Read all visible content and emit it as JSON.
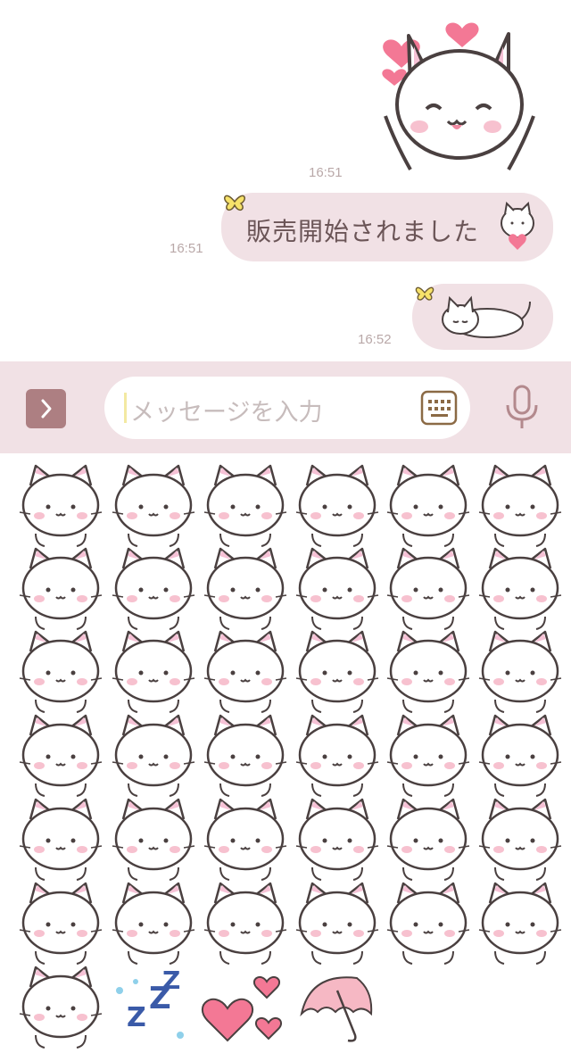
{
  "colors": {
    "bubble": "#f1e1e5",
    "bubble_text": "#6b5557",
    "time_text": "#b9a8a8",
    "composer_bg": "#f1e1e5",
    "toggle_button": "#ad7f82",
    "keyboard_icon": "#8b6a45",
    "mic_icon": "#b3898d",
    "sticker_outline": "#4a4040",
    "sticker_cheek": "#f7c1cf",
    "heart": "#f37895"
  },
  "messages": [
    {
      "kind": "sticker",
      "sticker": "cat-hearts-sticker",
      "time": "16:51"
    },
    {
      "kind": "text",
      "text": "販売開始されました",
      "inline_sticker": "cat-holding-heart-icon",
      "decoration": "butterfly-icon",
      "time": "16:51"
    },
    {
      "kind": "sticker-bubble",
      "sticker": "sleeping-cat-sticker",
      "decoration": "butterfly-icon",
      "time": "16:52"
    }
  ],
  "composer": {
    "toggle_icon": "chevron-right-icon",
    "placeholder": "メッセージを入力",
    "keyboard_icon": "keyboard-icon",
    "mic_icon": "microphone-icon"
  },
  "sticker_panel": {
    "items": [
      "cat-neutral",
      "cat-smile",
      "cat-question",
      "cat-exclaim",
      "cat-wave",
      "cat-happy-eyes-closed",
      "cat-annoyed",
      "cat-blank",
      "cat-paws-up",
      "cat-worried-sweat",
      "cat-covering-face",
      "cat-sweat-drop",
      "cat-tearful",
      "cat-thinking",
      "cat-cheeks",
      "cat-donut",
      "cat-hearts",
      "cat-splash",
      "cat-sitting",
      "cat-back-view",
      "cat-holding-heart",
      "cat-broken-heart",
      "cat-nightcap",
      "cat-yarn-ball",
      "cat-under-blanket",
      "cat-pillow",
      "cat-bow-tie",
      "cat-crying",
      "cat-gloom-lines",
      "cat-pointing",
      "cat-sleepy",
      "cat-unamused",
      "cat-hair-bow",
      "cat-hugging",
      "cat-lying",
      "cat-plug-tail",
      "cat-sad",
      "zzz",
      "hearts",
      "umbrella"
    ]
  }
}
